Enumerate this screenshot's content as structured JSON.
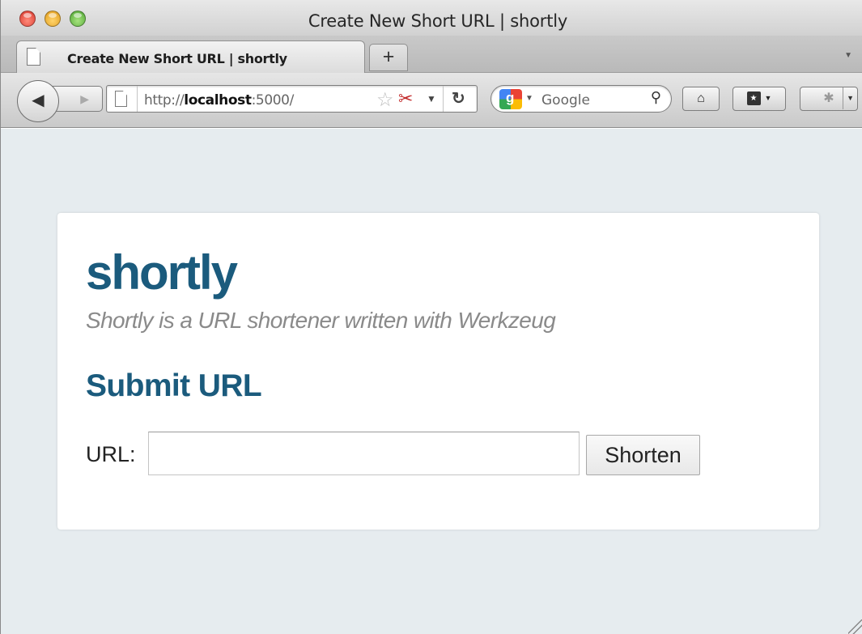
{
  "window": {
    "title": "Create New Short URL | shortly"
  },
  "tabs": [
    {
      "label": "Create New Short URL | shortly",
      "active": true
    }
  ],
  "toolbar": {
    "new_tab_label": "+",
    "address": {
      "scheme": "http://",
      "host": "localhost",
      "rest": ":5000/"
    },
    "search": {
      "engine": "Google",
      "placeholder": "Google"
    },
    "icons": [
      "back-arrow-icon",
      "forward-arrow-icon",
      "page-icon",
      "star-icon",
      "scissors-icon",
      "reload-icon",
      "google-icon",
      "magnifier-icon",
      "home-icon",
      "bookmark-icon",
      "extension-icon"
    ]
  },
  "page": {
    "site_title": "shortly",
    "tagline": "Shortly is a URL shortener written with Werkzeug",
    "section_heading": "Submit URL",
    "form": {
      "url_label": "URL:",
      "url_value": "",
      "submit_label": "Shorten"
    }
  },
  "colors": {
    "brand": "#1b5b7d",
    "tagline": "#8a8a8a",
    "page_background": "#e6ecef",
    "card_background": "#ffffff"
  }
}
